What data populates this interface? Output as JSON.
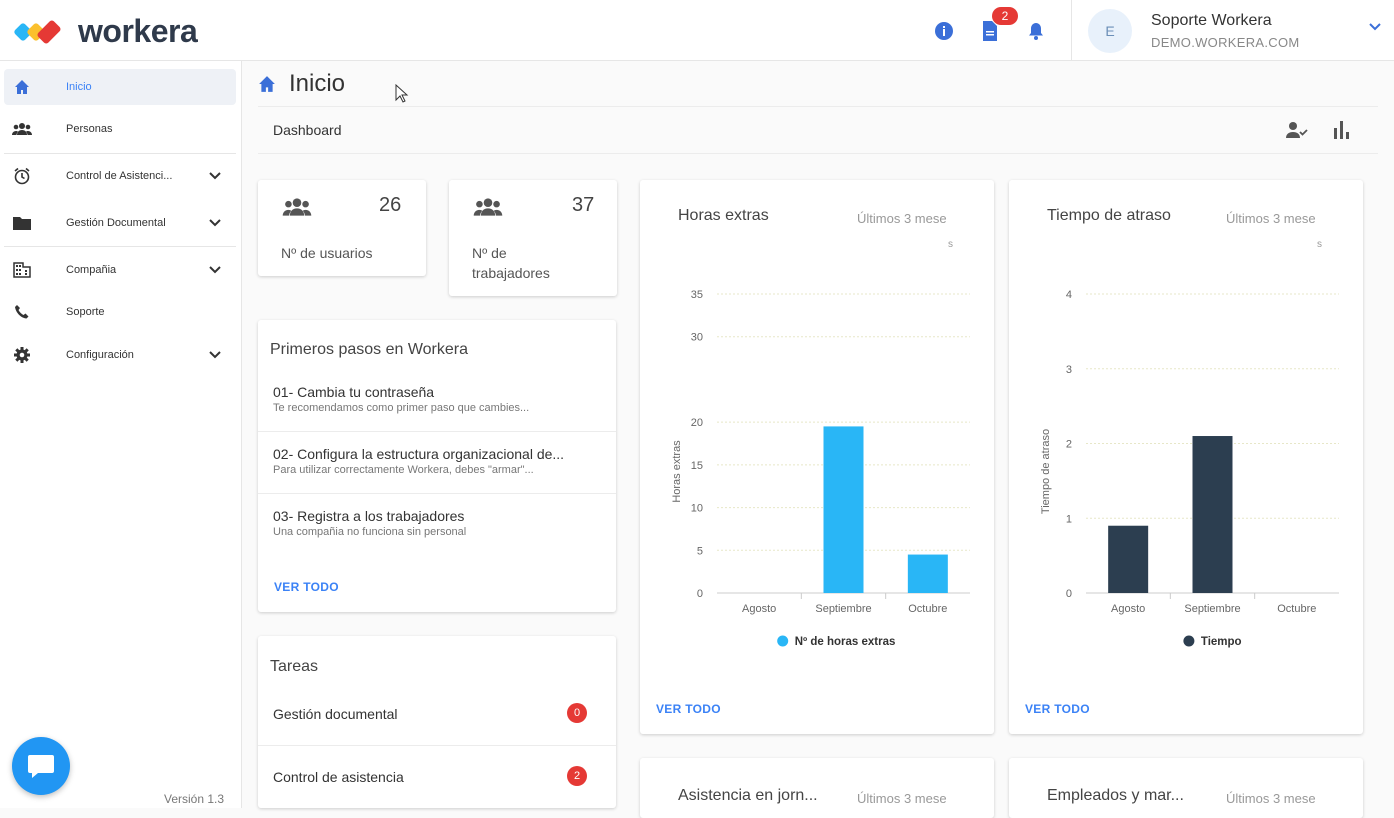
{
  "app": {
    "brand": "workera"
  },
  "header": {
    "notification_count": "2",
    "user_name": "Soporte Workera",
    "user_domain": "DEMO.WORKERA.COM",
    "avatar_initial": "E"
  },
  "sidebar": {
    "items": [
      {
        "label": "Inicio",
        "icon": "home-icon"
      },
      {
        "label": "Personas",
        "icon": "people-icon"
      },
      {
        "label": "Control de Asistenci...",
        "icon": "alarm-icon"
      },
      {
        "label": "Gestión Documental",
        "icon": "folder-icon"
      },
      {
        "label": "Compañia",
        "icon": "building-icon"
      },
      {
        "label": "Soporte",
        "icon": "phone-icon"
      },
      {
        "label": "Configuración",
        "icon": "gear-icon"
      }
    ],
    "version": "Versión 1.3"
  },
  "page": {
    "title": "Inicio",
    "breadcrumb": "Dashboard"
  },
  "stats": [
    {
      "value": "26",
      "label": "Nº de usuarios"
    },
    {
      "value": "37",
      "label": "Nº de trabajadores"
    }
  ],
  "first_steps": {
    "title": "Primeros pasos en Workera",
    "items": [
      {
        "title": "01- Cambia tu contraseña",
        "desc": "Te recomendamos como primer paso que cambies..."
      },
      {
        "title": "02- Configura la estructura organizacional de...",
        "desc": "Para utilizar correctamente Workera, debes \"armar\"..."
      },
      {
        "title": "03- Registra a los trabajadores",
        "desc": "Una compañia no funciona sin personal"
      }
    ],
    "link": "VER TODO"
  },
  "tasks": {
    "title": "Tareas",
    "items": [
      {
        "label": "Gestión documental",
        "count": "0"
      },
      {
        "label": "Control de asistencia",
        "count": "2"
      }
    ]
  },
  "charts_meta": [
    {
      "title": "Horas extras",
      "period_line1": "Últimos 3 mese",
      "period_line2": "s",
      "link": "VER TODO"
    },
    {
      "title": "Tiempo de atraso",
      "period_line1": "Últimos 3 mese",
      "period_line2": "s",
      "link": "VER TODO"
    }
  ],
  "bottom_cards": [
    {
      "title": "Asistencia en jorn...",
      "period": "Últimos 3 mese"
    },
    {
      "title": "Empleados y mar...",
      "period": "Últimos 3 mese"
    }
  ],
  "chart_data": [
    {
      "type": "bar",
      "title": "Horas extras",
      "categories": [
        "Agosto",
        "Septiembre",
        "Octubre"
      ],
      "series": [
        {
          "name": "Nº de horas extras",
          "values": [
            0,
            19.5,
            4.5
          ],
          "color": "#29b6f6"
        }
      ],
      "ylabel": "Horas extras",
      "ylim": [
        0,
        35
      ],
      "yticks": [
        0,
        5,
        10,
        15,
        20,
        30,
        35
      ],
      "legend": "bottom",
      "grid": true
    },
    {
      "type": "bar",
      "title": "Tiempo de atraso",
      "categories": [
        "Agosto",
        "Septiembre",
        "Octubre"
      ],
      "series": [
        {
          "name": "Tiempo",
          "values": [
            0.9,
            2.1,
            0
          ],
          "color": "#2c3e50"
        }
      ],
      "ylabel": "Tiempo de atraso",
      "ylim": [
        0,
        4
      ],
      "yticks": [
        0,
        1,
        2,
        3,
        4
      ],
      "legend": "bottom",
      "grid": true
    }
  ]
}
